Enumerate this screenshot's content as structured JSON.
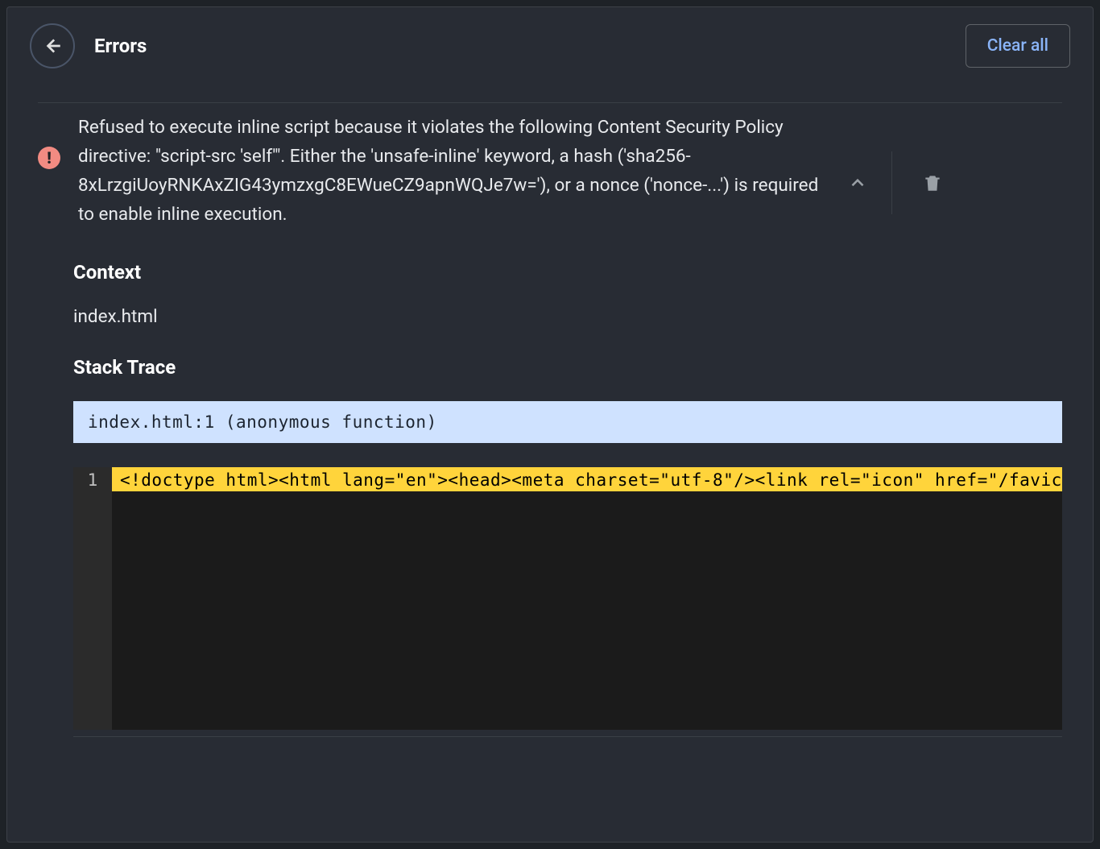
{
  "header": {
    "title": "Errors",
    "clear_all": "Clear all"
  },
  "error": {
    "message": "Refused to execute inline script because it violates the following Content Security Policy directive: \"script-src 'self'\". Either the 'unsafe-inline' keyword, a hash ('sha256-8xLrzgiUoyRNKAxZIG43ymzxgC8EWueCZ9apnWQJe7w='), or a nonce ('nonce-...') is required to enable inline execution."
  },
  "context": {
    "heading": "Context",
    "value": "index.html"
  },
  "stacktrace": {
    "heading": "Stack Trace",
    "frame": "index.html:1 (anonymous function)"
  },
  "code": {
    "line_number": "1",
    "content": "<!doctype html><html lang=\"en\"><head><meta charset=\"utf-8\"/><link rel=\"icon\" href=\"/favicon"
  }
}
